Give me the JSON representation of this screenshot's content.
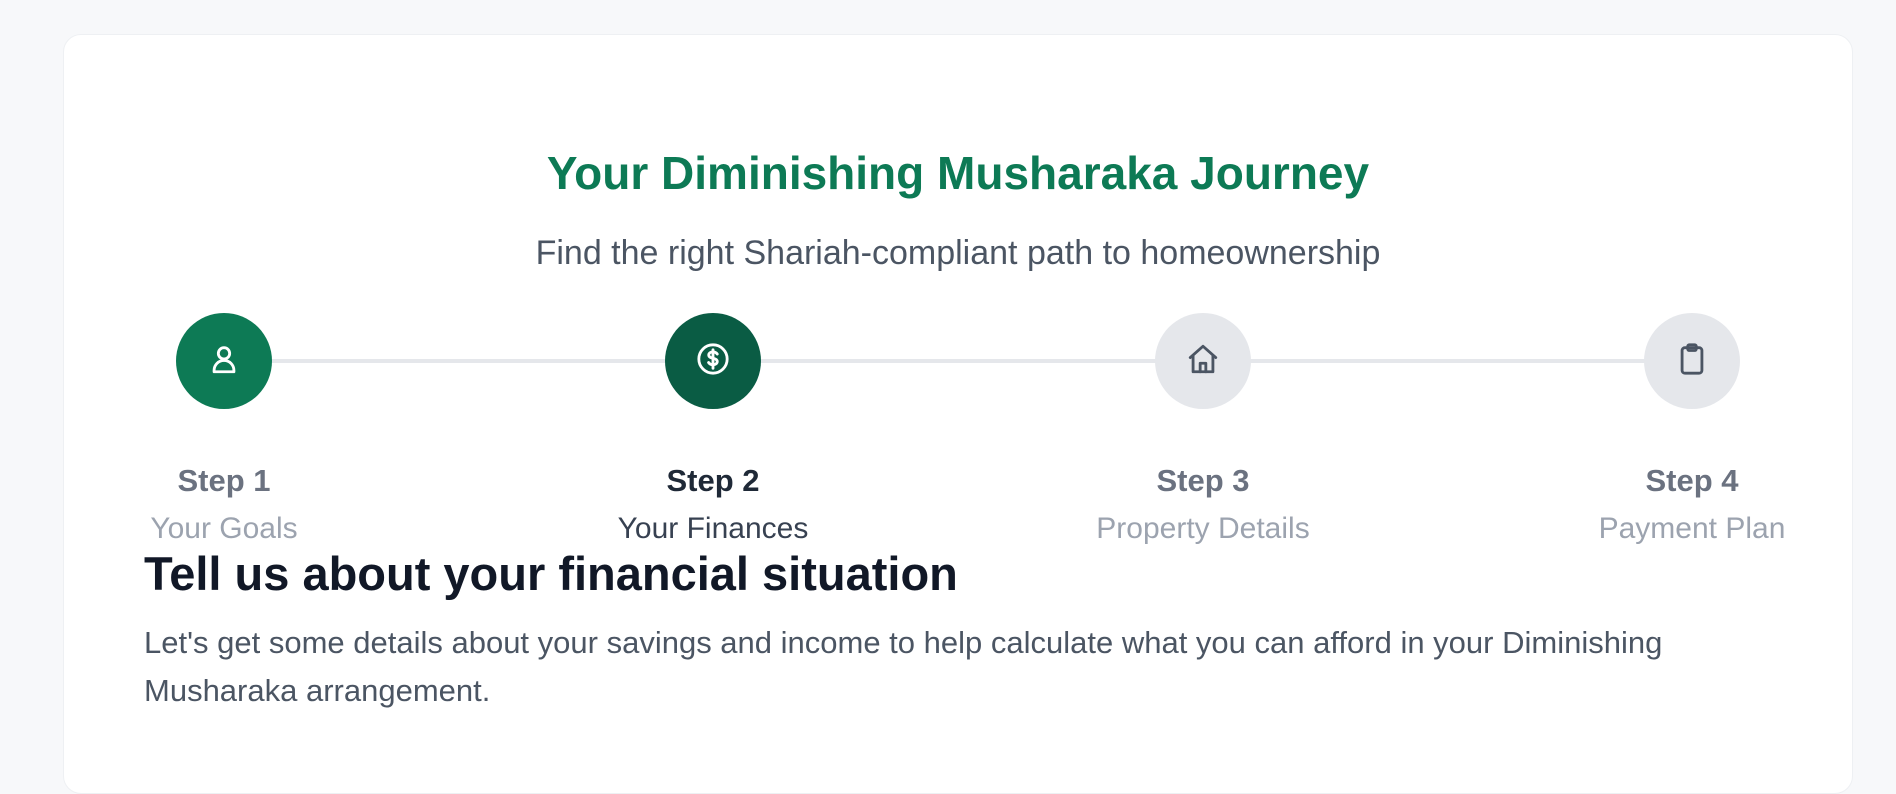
{
  "header": {
    "title": "Your Diminishing Musharaka Journey",
    "subtitle": "Find the right Shariah-compliant path to homeownership"
  },
  "steps": [
    {
      "number": "Step 1",
      "name": "Your Goals",
      "icon": "user-icon",
      "state": "completed"
    },
    {
      "number": "Step 2",
      "name": "Your Finances",
      "icon": "dollar-circle-icon",
      "state": "active"
    },
    {
      "number": "Step 3",
      "name": "Property Details",
      "icon": "home-icon",
      "state": "upcoming"
    },
    {
      "number": "Step 4",
      "name": "Payment Plan",
      "icon": "clipboard-icon",
      "state": "upcoming"
    }
  ],
  "section": {
    "heading": "Tell us about your financial situation",
    "description": "Let's get some details about your savings and income to help calculate what you can afford in your Diminishing Musharaka arrangement."
  },
  "colors": {
    "brand": "#0d7a55",
    "brand_dark": "#0a5c44",
    "inactive": "#e5e7eb"
  }
}
